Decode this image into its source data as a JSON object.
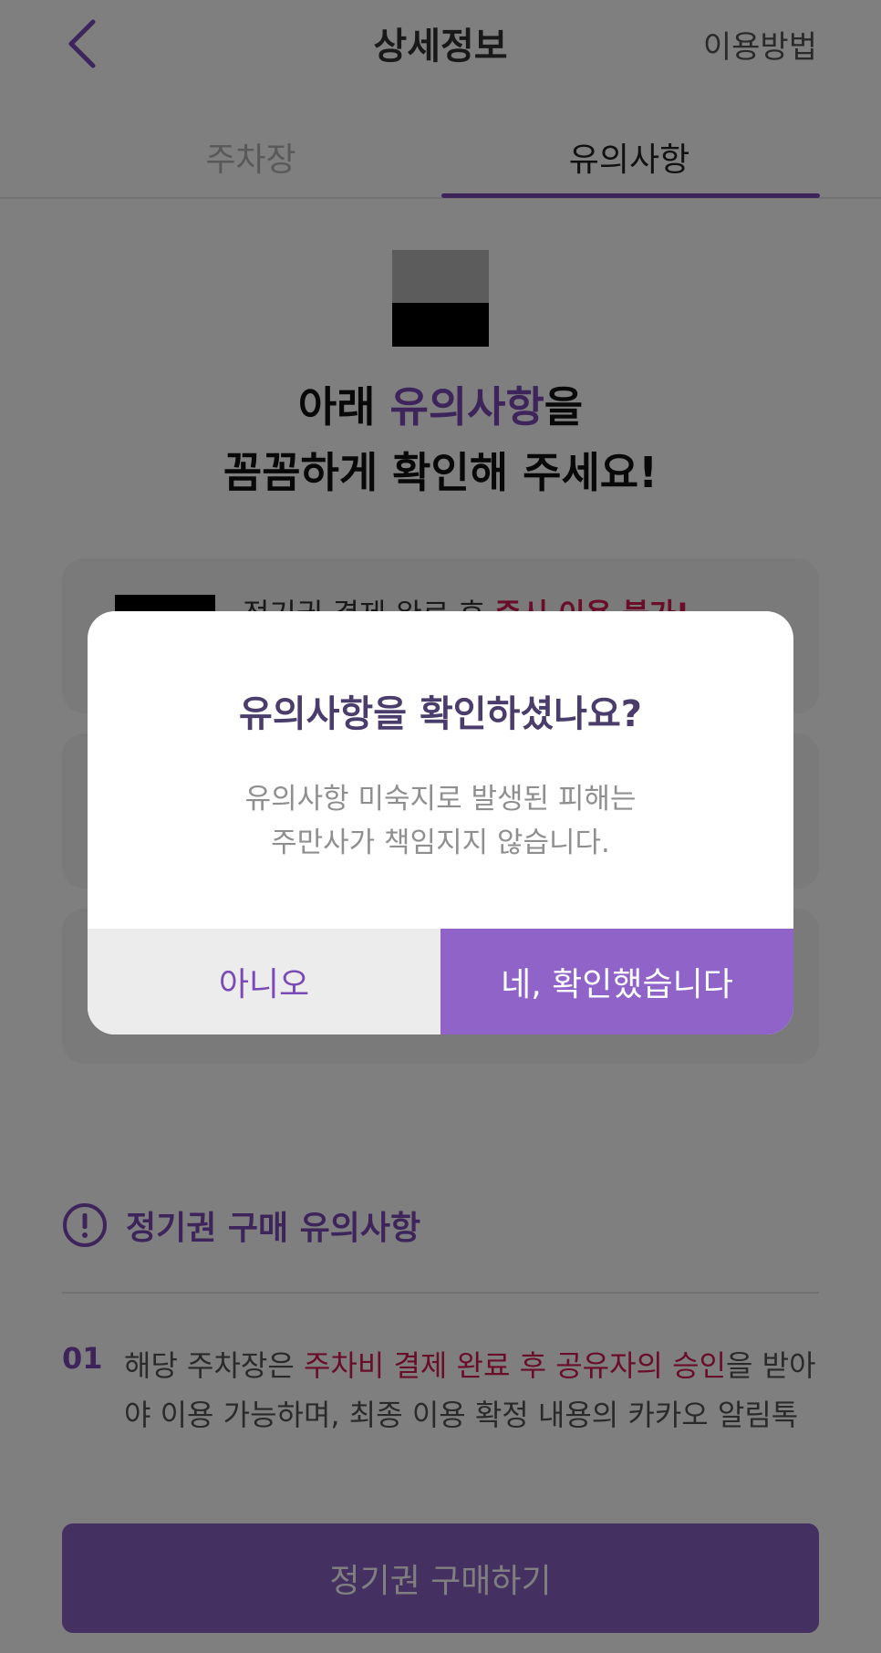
{
  "header": {
    "title": "상세정보",
    "help_link": "이용방법",
    "back_icon": "chevron-left-icon",
    "accent_color": "#7a4bb8"
  },
  "tabs": [
    {
      "label": "주차장",
      "selected": false
    },
    {
      "label": "유의사항",
      "selected": true
    }
  ],
  "hero": {
    "line1_prefix": "아래 ",
    "line1_accent": "유의사항",
    "line1_suffix": "을",
    "line2": "꼼꼼하게 확인해 주세요!"
  },
  "cards": [
    {
      "text_prefix": "정기권 결제 완료 후 ",
      "text_warning": "즉시 이용 불가!"
    }
  ],
  "section": {
    "title": "정기권 구매 유의사항",
    "icon": "exclamation-circle-icon"
  },
  "notice": {
    "number": "01",
    "text_prefix": "해당 주차장은 ",
    "text_warning": "주차비 결제 완료 후 공유자의 승인",
    "text_suffix": "을 받아야 이용 가능하며, 최종 이용 확정 내용의 카카오 알림톡 및 APP Push 수신 이후에 이용 가능합니다."
  },
  "buy_button": "정기권 구매하기",
  "modal": {
    "title": "유의사항을 확인하셨나요?",
    "message_line1": "유의사항 미숙지로 발생된 피해는",
    "message_line2": "주만사가 책임지지 않습니다.",
    "no_label": "아니오",
    "yes_label": "네, 확인했습니다"
  }
}
